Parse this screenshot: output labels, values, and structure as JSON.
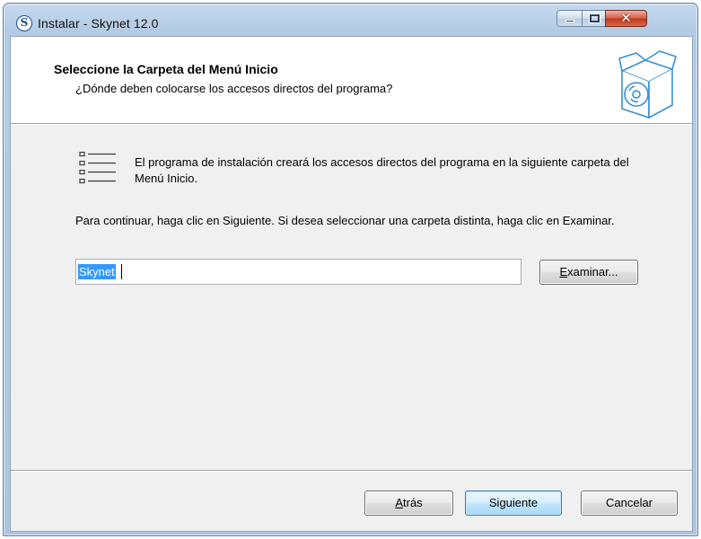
{
  "window": {
    "title": "Instalar - Skynet 12.0",
    "app_icon_letter": "S"
  },
  "header": {
    "title": "Seleccione la Carpeta del Menú Inicio",
    "subtitle": "¿Dónde deben colocarse los accesos directos del programa?"
  },
  "body": {
    "info_text": "El programa de instalación creará los accesos directos del programa en la siguiente carpeta del Menú Inicio.",
    "instruction_text": "Para continuar, haga clic en Siguiente. Si desea seleccionar una carpeta distinta, haga clic en Examinar.",
    "folder_value": "Skynet"
  },
  "buttons": {
    "browse_label": "Examinar...",
    "browse_accel": "E",
    "browse_rest": "xaminar...",
    "back_accel": "A",
    "back_rest": "trás",
    "next_label": "Siguiente",
    "cancel_label": "Cancelar"
  },
  "colors": {
    "selection": "#3399ff",
    "default_button_border": "#3c7fb1",
    "close_button": "#c1381d"
  },
  "icons": {
    "app": "skynet-logo-icon",
    "header": "software-box-cd-icon",
    "list": "start-menu-list-icon"
  }
}
